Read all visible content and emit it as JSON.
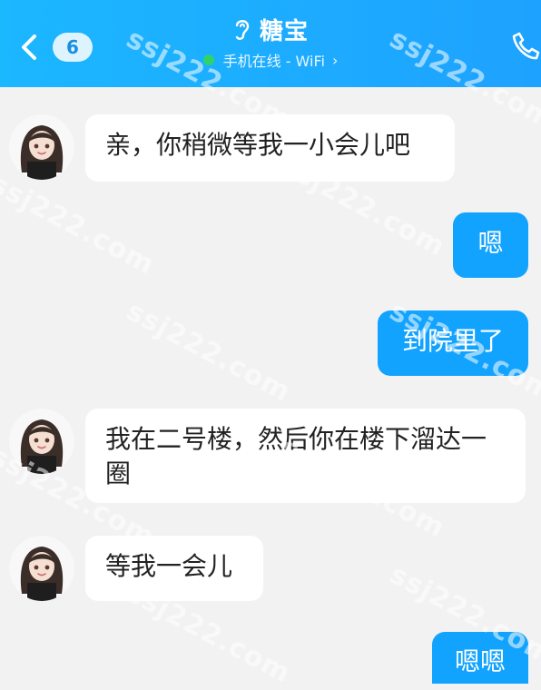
{
  "header": {
    "badge_count": "6",
    "title": "糖宝",
    "status_text": "手机在线 - WiFi",
    "status_chevron": "›"
  },
  "icons": {
    "back": "chevron-left-icon",
    "ear": "ear-icon",
    "phone": "phone-icon",
    "status_dot": "online-dot-icon"
  },
  "colors": {
    "header_gradient_start": "#1bb7ff",
    "header_gradient_end": "#1ea2ff",
    "right_bubble": "#12a3ff",
    "left_bubble": "#ffffff",
    "background": "#f2f2f2",
    "online_dot": "#2ed36b"
  },
  "messages": [
    {
      "side": "left",
      "text": "亲，你稍微等我一小会儿吧"
    },
    {
      "side": "right",
      "text": "嗯"
    },
    {
      "side": "right",
      "text": "到院里了"
    },
    {
      "side": "left",
      "text": "我在二号楼，然后你在楼下溜达一圈"
    },
    {
      "side": "left",
      "text": "等我一会儿"
    },
    {
      "side": "right",
      "text": "嗯嗯"
    }
  ],
  "watermark": "ssj222.com"
}
